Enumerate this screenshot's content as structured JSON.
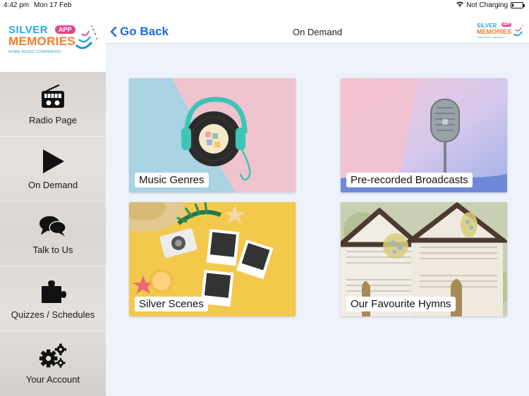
{
  "status": {
    "time": "4:42 pm",
    "date": "Mon 17 Feb",
    "charging": "Not Charging",
    "battery_level": 0.15
  },
  "logo": {
    "line1": "SILVER",
    "line2": "MEMORIES",
    "badge": "APP",
    "tagline": "HOME MUSIC COMPANION"
  },
  "header": {
    "back_label": "Go Back",
    "title": "On Demand"
  },
  "nav": {
    "items": [
      {
        "label": "Radio Page",
        "icon": "radio-icon"
      },
      {
        "label": "On Demand",
        "icon": "play-icon"
      },
      {
        "label": "Talk to Us",
        "icon": "chat-bubbles-icon"
      },
      {
        "label": "Quizzes / Schedules",
        "icon": "puzzle-piece-icon"
      },
      {
        "label": "Your Account",
        "icon": "gears-icon"
      }
    ]
  },
  "cards": [
    {
      "label": "Music Genres"
    },
    {
      "label": "Pre-recorded Broadcasts"
    },
    {
      "label": "Silver Scenes"
    },
    {
      "label": "Our Favourite Hymns"
    }
  ],
  "colors": {
    "accent": "#1a6fe0",
    "logo_blue": "#2aa9e0",
    "logo_orange": "#ef7d2c",
    "logo_pink": "#e0478b",
    "content_bg": "#eef3fb"
  }
}
